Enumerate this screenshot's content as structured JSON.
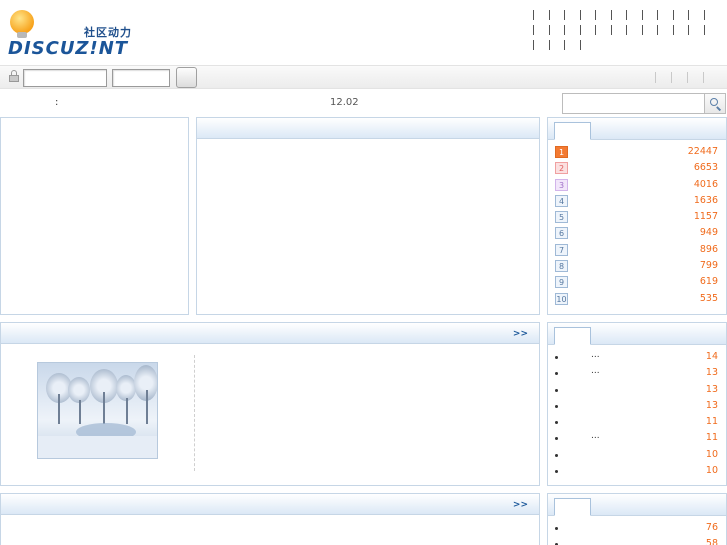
{
  "header": {
    "logo_cn": "社区动力",
    "logo_en": "DISCUZ!NT",
    "toplinks_row1_count": 12,
    "toplinks_row2_count": 12,
    "toplinks_row3_count": 4
  },
  "loginbar": {
    "right_separator_count": 4
  },
  "infobar": {
    "colon": ":",
    "version": "12.02"
  },
  "panels": {
    "top_center": {
      "title": ""
    },
    "middle": {
      "more": ">>"
    },
    "bottom": {
      "more": ">>"
    }
  },
  "ranking": {
    "items": [
      {
        "rank": "1",
        "value": "22447"
      },
      {
        "rank": "2",
        "value": "6653"
      },
      {
        "rank": "3",
        "value": "4016"
      },
      {
        "rank": "4",
        "value": "1636"
      },
      {
        "rank": "5",
        "value": "1157"
      },
      {
        "rank": "6",
        "value": "949"
      },
      {
        "rank": "7",
        "value": "896"
      },
      {
        "rank": "8",
        "value": "799"
      },
      {
        "rank": "9",
        "value": "619"
      },
      {
        "rank": "10",
        "value": "535"
      }
    ]
  },
  "hot_list": {
    "items": [
      {
        "ellipsis": "...",
        "count": "14"
      },
      {
        "ellipsis": "...",
        "count": "13"
      },
      {
        "ellipsis": "",
        "count": "13"
      },
      {
        "ellipsis": "",
        "count": "13"
      },
      {
        "ellipsis": "",
        "count": "11"
      },
      {
        "ellipsis": "...",
        "count": "11"
      },
      {
        "ellipsis": "",
        "count": "10"
      },
      {
        "ellipsis": "",
        "count": "10"
      }
    ]
  },
  "reply_list": {
    "items": [
      {
        "count": "76"
      },
      {
        "count": "58"
      }
    ]
  },
  "colors": {
    "accent_blue": "#1b5599",
    "count_orange": "#f06b1c",
    "panel_border": "#c6d6e6"
  }
}
